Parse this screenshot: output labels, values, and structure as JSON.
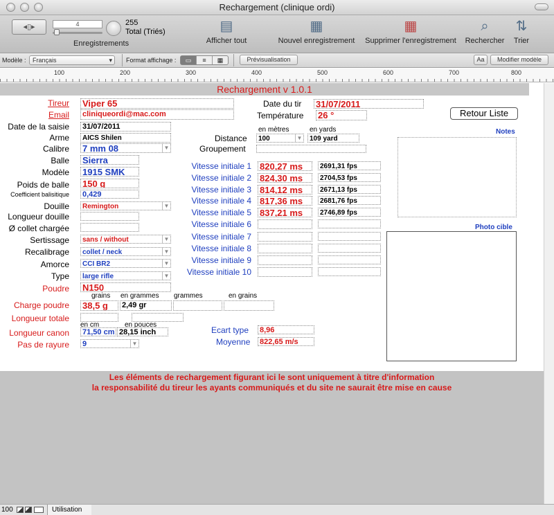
{
  "window": {
    "title": "Rechargement (clinique ordi)"
  },
  "toolbar": {
    "record_number": "4",
    "record_count": "255",
    "record_total": "Total (Triés)",
    "records_label": "Enregistrements",
    "show_all": "Afficher tout",
    "new_record": "Nouvel enregistrement",
    "delete_record": "Supprimer l'enregistrement",
    "find": "Rechercher",
    "sort": "Trier"
  },
  "statusbar": {
    "model_label": "Modèle :",
    "model_value": "Français",
    "format_label": "Format affichage :",
    "preview": "Prévisualisation",
    "aa": "Aa",
    "modify_model": "Modifier modèle"
  },
  "ruler": {
    "ticks": [
      "100",
      "200",
      "300",
      "400",
      "500",
      "600",
      "700",
      "800"
    ]
  },
  "form": {
    "header": "Rechargement v 1.0.1",
    "labels": {
      "tireur": "Tireur",
      "email": "Email",
      "date_saisie": "Date de la saisie",
      "arme": "Arme",
      "calibre": "Calibre",
      "balle": "Balle",
      "modele": "Modèle",
      "poids": "Poids de balle",
      "coef": "Coefficient balisitique",
      "douille": "Douille",
      "longueur_douille": "Longueur douille",
      "collet": "Ø collet chargée",
      "sertissage": "Sertissage",
      "recalibrage": "Recalibrage",
      "amorce": "Amorce",
      "type": "Type",
      "poudre": "Poudre",
      "charge": "Charge poudre",
      "longueur_totale": "Longueur totale",
      "longueur_canon": "Longueur canon",
      "pas": "Pas de rayure",
      "date_tir": "Date du tir",
      "temperature": "Température",
      "distance": "Distance",
      "groupement": "Groupement",
      "en_metres": "en mètres",
      "en_yards": "en yards",
      "grains": "grains",
      "en_grammes": "en grammes",
      "grammes": "grammes",
      "en_grains": "en grains",
      "en_cm": "en cm",
      "en_pouces": "en pouces",
      "ecart_type": "Ecart type",
      "moyenne": "Moyenne",
      "notes": "Notes",
      "photo": "Photo cible",
      "retour": "Retour Liste"
    },
    "values": {
      "tireur": "Viper 65",
      "email": "cliniqueordi@mac.com",
      "date_saisie": "31/07/2011",
      "arme": "AICS Shilen",
      "calibre": "7 mm 08",
      "balle": "Sierra",
      "modele": "1915 SMK",
      "poids": "150 g",
      "coef": "0,429",
      "douille": "Remington",
      "sertissage": "sans / without",
      "recalibrage": "collet / neck",
      "amorce": "CCI BR2",
      "type": "large rifle",
      "poudre": "N150",
      "charge_grains": "38,5 g",
      "charge_grammes": "2,49 gr",
      "canon_cm": "71,50 cm",
      "canon_pouces": "28,15 inch",
      "pas": "9",
      "date_tir": "31/07/2011",
      "temperature": "26 °",
      "distance_m": "100",
      "distance_yd": "109 yard",
      "ecart_type": "8,96",
      "moyenne": "822,65 m/s"
    },
    "vitesses": [
      {
        "label": "Vitesse initiale 1",
        "ms": "820,27 ms",
        "fps": "2691,31 fps"
      },
      {
        "label": "Vitesse initiale 2",
        "ms": "824,30 ms",
        "fps": "2704,53 fps"
      },
      {
        "label": "Vitesse initiale 3",
        "ms": "814,12 ms",
        "fps": "2671,13 fps"
      },
      {
        "label": "Vitesse initiale 4",
        "ms": "817,36 ms",
        "fps": "2681,76 fps"
      },
      {
        "label": "Vitesse initiale 5",
        "ms": "837,21 ms",
        "fps": "2746,89 fps"
      },
      {
        "label": "Vitesse initiale 6",
        "ms": "",
        "fps": ""
      },
      {
        "label": "Vitesse initiale 7",
        "ms": "",
        "fps": ""
      },
      {
        "label": "Vitesse initiale 8",
        "ms": "",
        "fps": ""
      },
      {
        "label": "Vitesse initiale 9",
        "ms": "",
        "fps": ""
      },
      {
        "label": "Vitesse initiale 10",
        "ms": "",
        "fps": ""
      }
    ]
  },
  "disclaimer": {
    "line1": "Les éléments de rechargement figurant ici le sont uniquement à titre d'information",
    "line2": "la responsabilité du tireur les ayants communiqués et du site ne saurait être mise en cause"
  },
  "footer": {
    "zoom": "100",
    "mode": "Utilisation"
  }
}
